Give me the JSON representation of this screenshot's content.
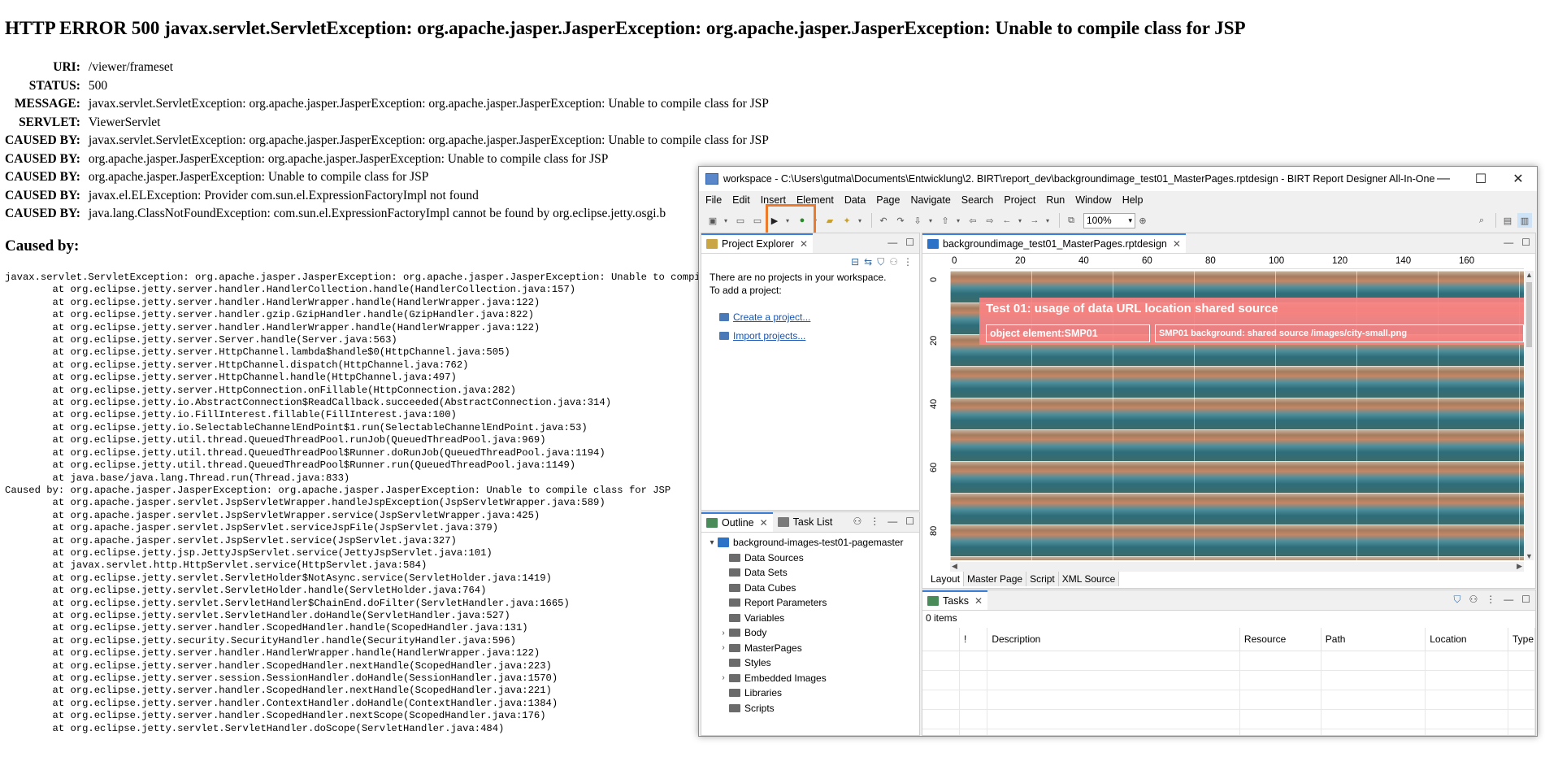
{
  "error_page": {
    "heading": "HTTP ERROR 500 javax.servlet.ServletException: org.apache.jasper.JasperException: org.apache.jasper.JasperException: Unable to compile class for JSP",
    "fields": [
      {
        "label": "URI:",
        "value": "/viewer/frameset"
      },
      {
        "label": "STATUS:",
        "value": "500"
      },
      {
        "label": "MESSAGE:",
        "value": "javax.servlet.ServletException: org.apache.jasper.JasperException: org.apache.jasper.JasperException: Unable to compile class for JSP"
      },
      {
        "label": "SERVLET:",
        "value": "ViewerServlet"
      },
      {
        "label": "CAUSED BY:",
        "value": "javax.servlet.ServletException: org.apache.jasper.JasperException: org.apache.jasper.JasperException: Unable to compile class for JSP"
      },
      {
        "label": "CAUSED BY:",
        "value": "org.apache.jasper.JasperException: org.apache.jasper.JasperException: Unable to compile class for JSP"
      },
      {
        "label": "CAUSED BY:",
        "value": "org.apache.jasper.JasperException: Unable to compile class for JSP"
      },
      {
        "label": "CAUSED BY:",
        "value": "javax.el.ELException: Provider com.sun.el.ExpressionFactoryImpl not found"
      },
      {
        "label": "CAUSED BY:",
        "value": "java.lang.ClassNotFoundException: com.sun.el.ExpressionFactoryImpl cannot be found by org.eclipse.jetty.osgi.b"
      }
    ],
    "caused_by_heading": "Caused by:",
    "trace": [
      "javax.servlet.ServletException: org.apache.jasper.JasperException: org.apache.jasper.JasperException: Unable to compile",
      "\tat org.eclipse.jetty.server.handler.HandlerCollection.handle(HandlerCollection.java:157)",
      "\tat org.eclipse.jetty.server.handler.HandlerWrapper.handle(HandlerWrapper.java:122)",
      "\tat org.eclipse.jetty.server.handler.gzip.GzipHandler.handle(GzipHandler.java:822)",
      "\tat org.eclipse.jetty.server.handler.HandlerWrapper.handle(HandlerWrapper.java:122)",
      "\tat org.eclipse.jetty.server.Server.handle(Server.java:563)",
      "\tat org.eclipse.jetty.server.HttpChannel.lambda$handle$0(HttpChannel.java:505)",
      "\tat org.eclipse.jetty.server.HttpChannel.dispatch(HttpChannel.java:762)",
      "\tat org.eclipse.jetty.server.HttpChannel.handle(HttpChannel.java:497)",
      "\tat org.eclipse.jetty.server.HttpConnection.onFillable(HttpConnection.java:282)",
      "\tat org.eclipse.jetty.io.AbstractConnection$ReadCallback.succeeded(AbstractConnection.java:314)",
      "\tat org.eclipse.jetty.io.FillInterest.fillable(FillInterest.java:100)",
      "\tat org.eclipse.jetty.io.SelectableChannelEndPoint$1.run(SelectableChannelEndPoint.java:53)",
      "\tat org.eclipse.jetty.util.thread.QueuedThreadPool.runJob(QueuedThreadPool.java:969)",
      "\tat org.eclipse.jetty.util.thread.QueuedThreadPool$Runner.doRunJob(QueuedThreadPool.java:1194)",
      "\tat org.eclipse.jetty.util.thread.QueuedThreadPool$Runner.run(QueuedThreadPool.java:1149)",
      "\tat java.base/java.lang.Thread.run(Thread.java:833)",
      "Caused by: org.apache.jasper.JasperException: org.apache.jasper.JasperException: Unable to compile class for JSP",
      "\tat org.apache.jasper.servlet.JspServletWrapper.handleJspException(JspServletWrapper.java:589)",
      "\tat org.apache.jasper.servlet.JspServletWrapper.service(JspServletWrapper.java:425)",
      "\tat org.apache.jasper.servlet.JspServlet.serviceJspFile(JspServlet.java:379)",
      "\tat org.apache.jasper.servlet.JspServlet.service(JspServlet.java:327)",
      "\tat org.eclipse.jetty.jsp.JettyJspServlet.service(JettyJspServlet.java:101)",
      "\tat javax.servlet.http.HttpServlet.service(HttpServlet.java:584)",
      "\tat org.eclipse.jetty.servlet.ServletHolder$NotAsync.service(ServletHolder.java:1419)",
      "\tat org.eclipse.jetty.servlet.ServletHolder.handle(ServletHolder.java:764)",
      "\tat org.eclipse.jetty.servlet.ServletHandler$ChainEnd.doFilter(ServletHandler.java:1665)",
      "\tat org.eclipse.jetty.servlet.ServletHandler.doHandle(ServletHandler.java:527)",
      "\tat org.eclipse.jetty.server.handler.ScopedHandler.handle(ScopedHandler.java:131)",
      "\tat org.eclipse.jetty.security.SecurityHandler.handle(SecurityHandler.java:596)",
      "\tat org.eclipse.jetty.server.handler.HandlerWrapper.handle(HandlerWrapper.java:122)",
      "\tat org.eclipse.jetty.server.handler.ScopedHandler.nextHandle(ScopedHandler.java:223)",
      "\tat org.eclipse.jetty.server.session.SessionHandler.doHandle(SessionHandler.java:1570)",
      "\tat org.eclipse.jetty.server.handler.ScopedHandler.nextHandle(ScopedHandler.java:221)",
      "\tat org.eclipse.jetty.server.handler.ContextHandler.doHandle(ContextHandler.java:1384)",
      "\tat org.eclipse.jetty.server.handler.ScopedHandler.nextScope(ScopedHandler.java:176)",
      "\tat org.eclipse.jetty.servlet.ServletHandler.doScope(ServletHandler.java:484)"
    ]
  },
  "eclipse": {
    "title": "workspace - C:\\Users\\gutma\\Documents\\Entwicklung\\2. BIRT\\report_dev\\backgroundimage_test01_MasterPages.rptdesign - BIRT Report Designer All-In-One",
    "window_buttons": {
      "minimize": "—",
      "maximize": "☐",
      "close": "✕"
    },
    "menu": [
      "File",
      "Edit",
      "Insert",
      "Element",
      "Data",
      "Page",
      "Navigate",
      "Search",
      "Project",
      "Run",
      "Window",
      "Help"
    ],
    "zoom": "100%",
    "project_explorer": {
      "tab": "Project Explorer",
      "message_line1": "There are no projects in your workspace.",
      "message_line2": "To add a project:",
      "link_create": "Create a project...",
      "link_import": "Import projects..."
    },
    "outline": {
      "tab_outline": "Outline",
      "tab_tasklist": "Task List",
      "root": "background-images-test01-pagemaster",
      "items": [
        {
          "label": "Data Sources",
          "expandable": false
        },
        {
          "label": "Data Sets",
          "expandable": false
        },
        {
          "label": "Data Cubes",
          "expandable": false
        },
        {
          "label": "Report Parameters",
          "expandable": false
        },
        {
          "label": "Variables",
          "expandable": false
        },
        {
          "label": "Body",
          "expandable": true
        },
        {
          "label": "MasterPages",
          "expandable": true
        },
        {
          "label": "Styles",
          "expandable": false
        },
        {
          "label": "Embedded Images",
          "expandable": true
        },
        {
          "label": "Libraries",
          "expandable": false
        },
        {
          "label": "Scripts",
          "expandable": false
        }
      ]
    },
    "editor": {
      "tab": "backgroundimage_test01_MasterPages.rptdesign",
      "ruler_top": [
        "0",
        "20",
        "40",
        "60",
        "80",
        "100",
        "120",
        "140",
        "160"
      ],
      "ruler_left": [
        "0",
        "20",
        "40",
        "60",
        "80"
      ],
      "report_title": "Test 01: usage of data URL location shared source",
      "cell_left": "object element:SMP01",
      "cell_right": "SMP01 background: shared source /images/city-small.png",
      "bottom_tabs": [
        "Layout",
        "Master Page",
        "Script",
        "XML Source"
      ]
    },
    "tasks": {
      "tab": "Tasks",
      "count": "0 items",
      "columns": [
        "",
        "!",
        "Description",
        "Resource",
        "Path",
        "Location",
        "Type"
      ]
    },
    "colors": {
      "highlight": "#ec7a2c",
      "accent": "#3c7fd8",
      "report_pink": "#fa8282"
    }
  }
}
